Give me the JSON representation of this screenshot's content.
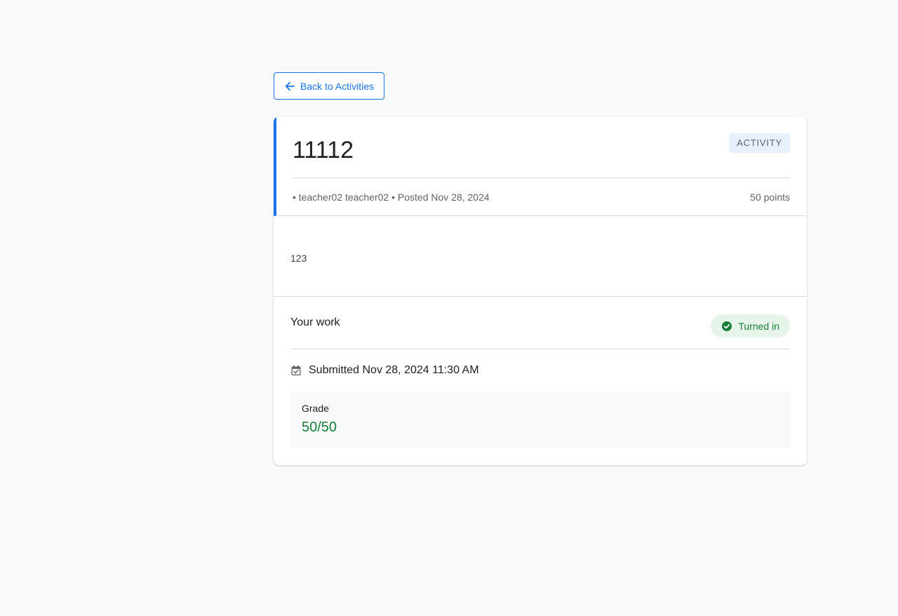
{
  "navigation": {
    "back_label": "Back to Activities",
    "back_icon": "arrow-left-icon"
  },
  "activity": {
    "title": "11112",
    "type_badge": "ACTIVITY",
    "meta": "• teacher02 teacher02 • Posted Nov 28, 2024",
    "points": "50 points",
    "description": "123"
  },
  "work": {
    "title": "Your work",
    "status": "Turned in",
    "status_icon": "check-circle-icon",
    "submitted": "Submitted Nov 28, 2024 11:30 AM",
    "submitted_icon": "calendar-check-icon",
    "grade_label": "Grade",
    "grade_value": "50/50"
  },
  "colors": {
    "accent": "#1a73e8",
    "success": "#188038",
    "success_bg": "#e6f4ea",
    "badge_bg": "#e8f0fe",
    "page_bg": "#f8f9fa"
  }
}
